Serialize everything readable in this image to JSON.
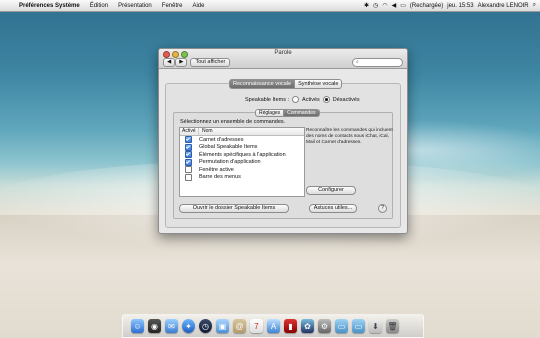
{
  "menubar": {
    "app_name": "Préférences Système",
    "items": [
      "Édition",
      "Présentation",
      "Fenêtre",
      "Aide"
    ],
    "battery_status": "(Rechargée)",
    "clock": "jeu. 15:53",
    "user": "Alexandre LENOIR"
  },
  "window": {
    "title": "Parole",
    "show_all_label": "Tout afficher",
    "search_placeholder": "",
    "main_tabs": [
      "Reconnaissance vocale",
      "Synthèse vocale"
    ],
    "speakable_label": "Speakable Items :",
    "radio_on_label": "Activés",
    "radio_off_label": "Désactivés",
    "selected_radio": "Désactivés",
    "inner_tabs": [
      "Réglages",
      "Commandes"
    ],
    "commands_heading": "Sélectionnez un ensemble de commandes.",
    "list_headers": [
      "Activé",
      "Nom"
    ],
    "commands": [
      {
        "label": "Carnet d'adresses",
        "checked": true
      },
      {
        "label": "Global Speakable Items",
        "checked": true
      },
      {
        "label": "Éléments spécifiques à l'application",
        "checked": true
      },
      {
        "label": "Permutation d'application",
        "checked": true
      },
      {
        "label": "Fenêtre active",
        "checked": false
      },
      {
        "label": "Barre des menus",
        "checked": false
      }
    ],
    "description": "Reconnaître les commandes qui incluent des noms de contacts sous iChat, iCal, Mail et Carnet d'adresses.",
    "configure_button": "Configurer",
    "open_folder_button": "Ouvrir le dossier Speakable Items",
    "utilities_button": "Astuces utiles...",
    "help_label": "?"
  },
  "dock": {
    "icons": [
      "finder-icon",
      "dashboard-icon",
      "mail-icon",
      "safari-icon",
      "time-machine-icon",
      "preview-icon",
      "itunes-icon",
      "address-book-icon",
      "ical-icon",
      "app-store-icon",
      "photo-booth-icon",
      "iphoto-icon",
      "system-preferences-icon",
      "folder-icon",
      "documents-icon",
      "downloads-icon",
      "trash-icon"
    ]
  }
}
